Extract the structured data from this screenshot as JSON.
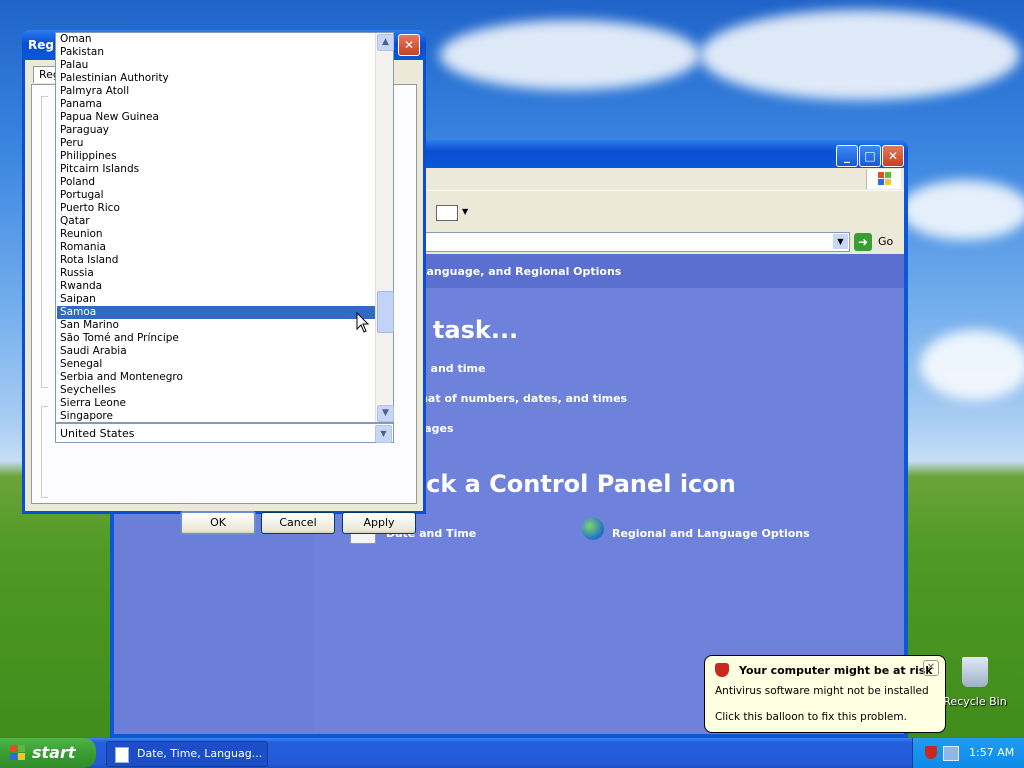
{
  "control_panel": {
    "header_text": "Date, Time, Language, and Regional Options",
    "go_label": "Go",
    "pick_task_heading": "Pick a task...",
    "tasks": [
      "Change the date and time",
      "Change the format of numbers, dates, and times",
      "Add other languages"
    ],
    "pick_icon_heading": "or pick a Control Panel icon",
    "icons": [
      {
        "label": "Date and Time",
        "icon": "calendar-clock-icon"
      },
      {
        "label": "Regional and Language Options",
        "icon": "globe-icon"
      }
    ]
  },
  "dialog": {
    "title": "Regional and Language Options",
    "tab_label": "Regional Options",
    "countries": [
      "Oman",
      "Pakistan",
      "Palau",
      "Palestinian Authority",
      "Palmyra Atoll",
      "Panama",
      "Papua New Guinea",
      "Paraguay",
      "Peru",
      "Philippines",
      "Pitcairn Islands",
      "Poland",
      "Portugal",
      "Puerto Rico",
      "Qatar",
      "Reunion",
      "Romania",
      "Rota Island",
      "Russia",
      "Rwanda",
      "Saipan",
      "Samoa",
      "San Marino",
      "São Tomé and Príncipe",
      "Saudi Arabia",
      "Senegal",
      "Serbia and Montenegro",
      "Seychelles",
      "Sierra Leone",
      "Singapore"
    ],
    "selected_country": "Samoa",
    "combo_value": "United States",
    "ok_label": "OK",
    "cancel_label": "Cancel",
    "apply_label": "Apply"
  },
  "balloon": {
    "title": "Your computer might be at risk",
    "line1": "Antivirus software might not be installed",
    "line2": "Click this balloon to fix this problem."
  },
  "desktop": {
    "recycle_bin_label": "Recycle Bin"
  },
  "taskbar": {
    "start_label": "start",
    "task_label": "Date, Time, Languag...",
    "clock": "1:57 AM"
  },
  "colors": {
    "selection": "#316ac5",
    "cp_panel": "#6b7fd9",
    "title_blue": "#0a4fd1"
  }
}
